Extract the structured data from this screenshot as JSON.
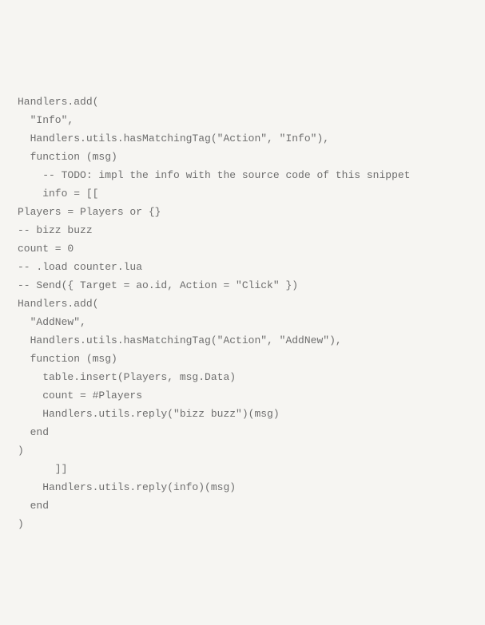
{
  "code": {
    "lines": [
      "Handlers.add(",
      "  \"Info\",",
      "  Handlers.utils.hasMatchingTag(\"Action\", \"Info\"),",
      "  function (msg)",
      "    -- TODO: impl the info with the source code of this snippet",
      "    info = [[",
      "Players = Players or {}",
      "",
      "-- bizz buzz",
      "count = 0",
      "-- .load counter.lua",
      "-- Send({ Target = ao.id, Action = \"Click\" })",
      "",
      "Handlers.add(",
      "  \"AddNew\",",
      "  Handlers.utils.hasMatchingTag(\"Action\", \"AddNew\"),",
      "  function (msg)",
      "    table.insert(Players, msg.Data)",
      "    count = #Players",
      "    Handlers.utils.reply(\"bizz buzz\")(msg)",
      "  end",
      ")",
      "      ]]",
      "    Handlers.utils.reply(info)(msg)",
      "  end",
      ")"
    ]
  }
}
